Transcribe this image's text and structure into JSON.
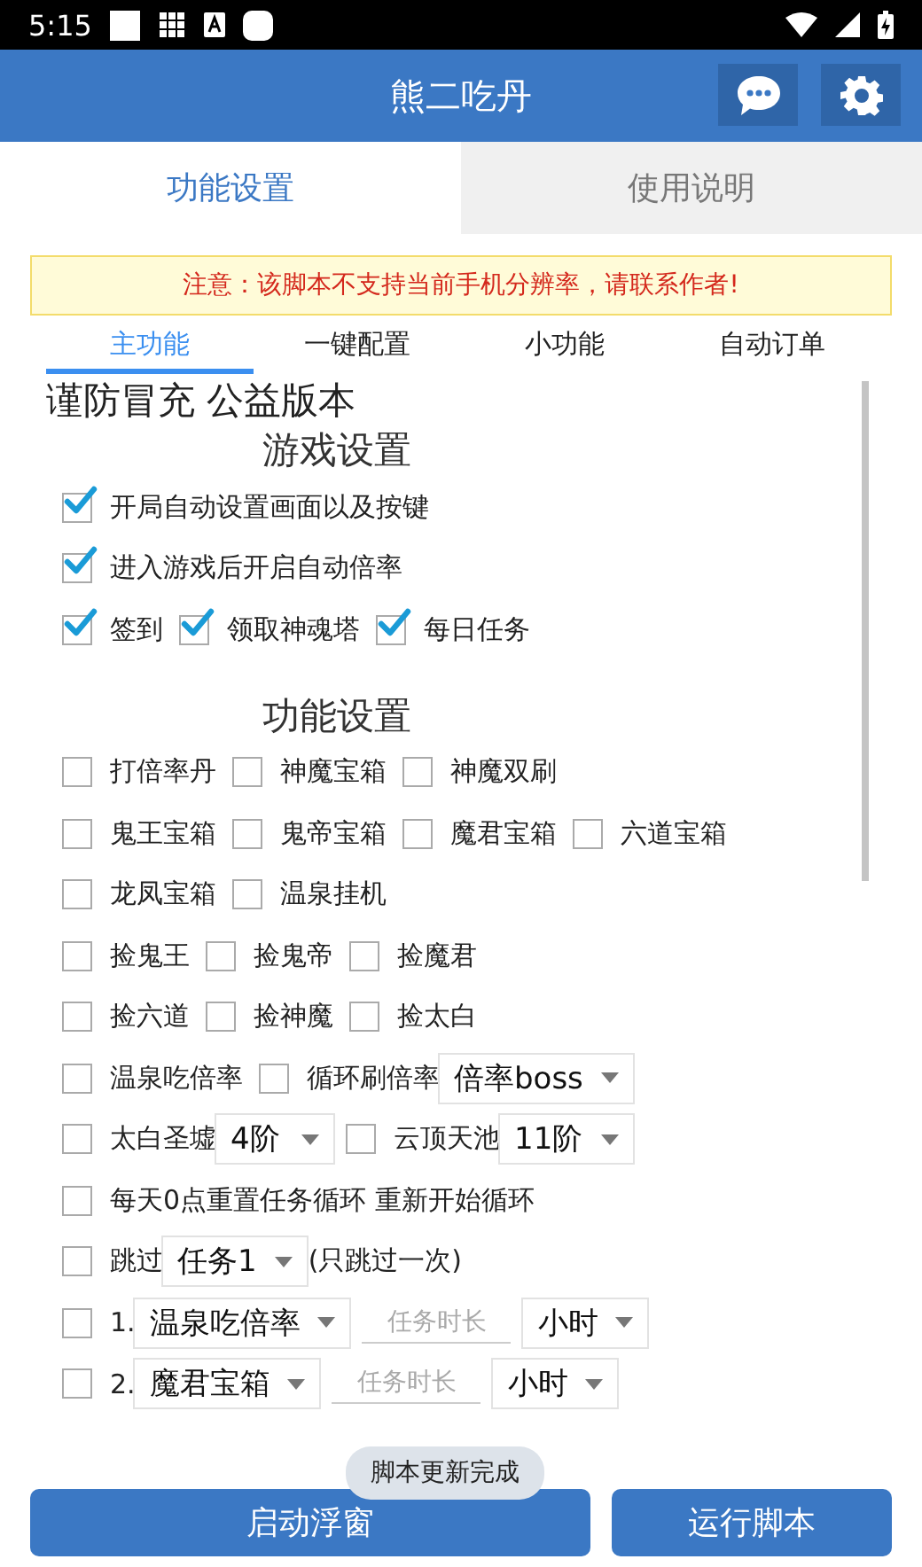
{
  "status_bar": {
    "time": "5:15"
  },
  "header": {
    "title": "熊二吃丹"
  },
  "tabs": [
    {
      "label": "功能设置",
      "selected": true
    },
    {
      "label": "使用说明",
      "selected": false
    }
  ],
  "notice": "注意：该脚本不支持当前手机分辨率，请联系作者!",
  "sub_tabs": [
    {
      "label": "主功能",
      "selected": true
    },
    {
      "label": "一键配置",
      "selected": false
    },
    {
      "label": "小功能",
      "selected": false
    },
    {
      "label": "自动订单",
      "selected": false
    }
  ],
  "version_title": "谨防冒充 公益版本",
  "sections": [
    {
      "title": "游戏设置",
      "rows": [
        [
          {
            "kind": "checkbox",
            "label": "开局自动设置画面以及按键",
            "checked": true
          }
        ],
        [
          {
            "kind": "checkbox",
            "label": "进入游戏后开启自动倍率",
            "checked": true
          }
        ],
        [
          {
            "kind": "checkbox",
            "label": "签到",
            "checked": true
          },
          {
            "kind": "checkbox",
            "label": "领取神魂塔",
            "checked": true
          },
          {
            "kind": "checkbox",
            "label": "每日任务",
            "checked": true
          }
        ]
      ]
    },
    {
      "title": "功能设置",
      "rows": [
        [
          {
            "kind": "checkbox",
            "label": "打倍率丹",
            "checked": false
          },
          {
            "kind": "checkbox",
            "label": "神魔宝箱",
            "checked": false
          },
          {
            "kind": "checkbox",
            "label": "神魔双刷",
            "checked": false
          }
        ],
        [
          {
            "kind": "checkbox",
            "label": "鬼王宝箱",
            "checked": false
          },
          {
            "kind": "checkbox",
            "label": "鬼帝宝箱",
            "checked": false
          },
          {
            "kind": "checkbox",
            "label": "魔君宝箱",
            "checked": false
          },
          {
            "kind": "checkbox",
            "label": "六道宝箱",
            "checked": false
          }
        ],
        [
          {
            "kind": "checkbox",
            "label": "龙凤宝箱",
            "checked": false
          },
          {
            "kind": "checkbox",
            "label": "温泉挂机",
            "checked": false
          }
        ],
        [
          {
            "kind": "checkbox",
            "label": "捡鬼王",
            "checked": false
          },
          {
            "kind": "checkbox",
            "label": "捡鬼帝",
            "checked": false
          },
          {
            "kind": "checkbox",
            "label": "捡魔君",
            "checked": false
          }
        ],
        [
          {
            "kind": "checkbox",
            "label": "捡六道",
            "checked": false
          },
          {
            "kind": "checkbox",
            "label": "捡神魔",
            "checked": false
          },
          {
            "kind": "checkbox",
            "label": "捡太白",
            "checked": false
          }
        ],
        [
          {
            "kind": "checkbox",
            "label": "温泉吃倍率",
            "checked": false
          },
          {
            "kind": "checkbox",
            "label": "循环刷倍率",
            "checked": false
          },
          {
            "kind": "select",
            "value": "倍率boss"
          }
        ],
        [
          {
            "kind": "checkbox",
            "label": "太白圣墟",
            "checked": false
          },
          {
            "kind": "select",
            "value": "4阶"
          },
          {
            "kind": "checkbox",
            "label": "云顶天池",
            "checked": false
          },
          {
            "kind": "select",
            "value": "11阶"
          }
        ],
        [
          {
            "kind": "checkbox",
            "label": "每天0点重置任务循环 重新开始循环",
            "checked": false
          }
        ],
        [
          {
            "kind": "checkbox",
            "label": "跳过",
            "checked": false
          },
          {
            "kind": "select",
            "value": "任务1"
          },
          {
            "kind": "text",
            "text": "(只跳过一次)"
          }
        ],
        [
          {
            "kind": "checkbox",
            "label": "1.",
            "checked": false
          },
          {
            "kind": "select",
            "value": "温泉吃倍率"
          },
          {
            "kind": "input",
            "placeholder": "任务时长"
          },
          {
            "kind": "select",
            "value": "小时"
          }
        ],
        [
          {
            "kind": "checkbox",
            "label": "2.",
            "checked": false
          },
          {
            "kind": "select",
            "value": "魔君宝箱"
          },
          {
            "kind": "input",
            "placeholder": "任务时长"
          },
          {
            "kind": "select",
            "value": "小时"
          }
        ]
      ]
    }
  ],
  "buttons": [
    "启动浮窗",
    "运行脚本"
  ],
  "toast": "脚本更新完成"
}
